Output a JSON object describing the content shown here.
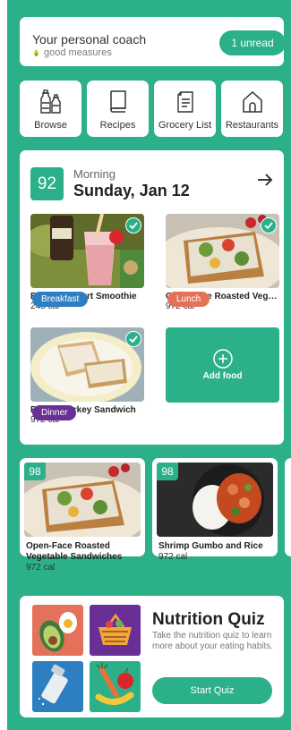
{
  "coach": {
    "title": "Your personal coach",
    "brand": "good measures",
    "unread_button": "1 unread"
  },
  "nav": [
    {
      "label": "Browse",
      "icon": "bottles-icon"
    },
    {
      "label": "Recipes",
      "icon": "book-icon"
    },
    {
      "label": "Grocery List",
      "icon": "list-icon"
    },
    {
      "label": "Restaurants",
      "icon": "house-icon"
    }
  ],
  "day": {
    "score": "92",
    "meal_time": "Morning",
    "date": "Sunday, Jan 12",
    "meals": [
      {
        "tag": "Breakfast",
        "name": "Banana Yogurt Smoothie",
        "cal": "243 cal",
        "tag_color": "#2e7fc1",
        "logged": true
      },
      {
        "tag": "Lunch",
        "name": "Open-Face Roasted Vege…",
        "cal": "972 cal",
        "tag_color": "#e4725a",
        "logged": true
      },
      {
        "tag": "Dinner",
        "name": "Brian's Turkey Sandwich",
        "cal": "972 cal",
        "tag_color": "#6a2f95",
        "logged": true
      }
    ],
    "add_food": "Add food"
  },
  "recommendations": [
    {
      "score": "98",
      "name": "Open-Face Roasted Vegetable Sandwiches",
      "cal": "972 cal"
    },
    {
      "score": "98",
      "name": "Shrimp Gumbo and Rice",
      "cal": "972 cal"
    }
  ],
  "quiz": {
    "title": "Nutrition Quiz",
    "description": "Take the nutrition quiz to learn more about your eating habits.",
    "button": "Start Quiz"
  },
  "colors": {
    "accent": "#2cb08a",
    "breakfast": "#2e7fc1",
    "lunch": "#e4725a",
    "dinner": "#6a2f95"
  }
}
